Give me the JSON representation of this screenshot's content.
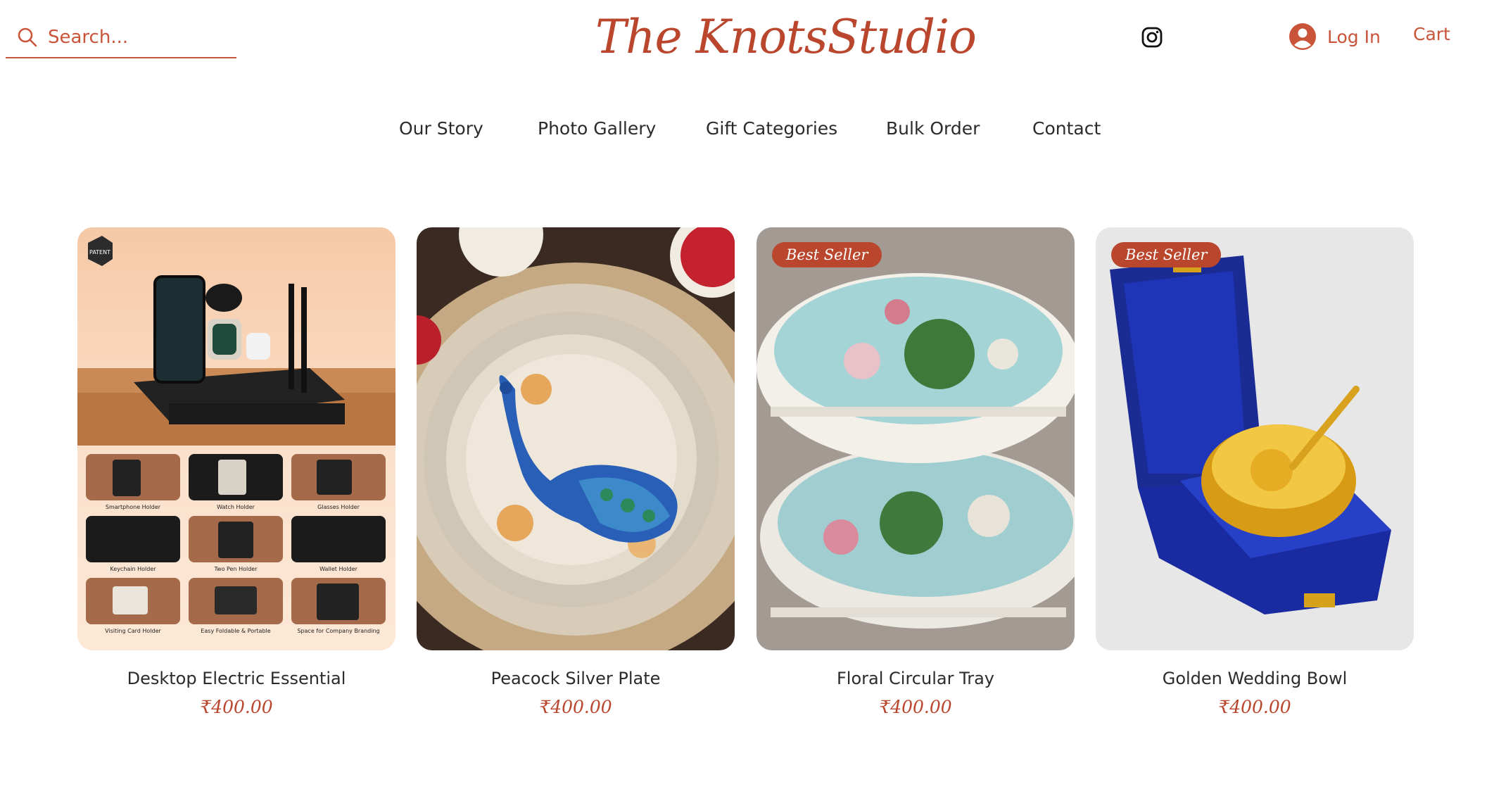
{
  "header": {
    "search_placeholder": "Search...",
    "logo": "The KnotsStudio",
    "login_label": "Log In",
    "cart_label": "Cart"
  },
  "nav": {
    "items": [
      "Our Story",
      "Photo Gallery",
      "Gift Categories",
      "Bulk Order",
      "Contact"
    ]
  },
  "products": [
    {
      "name": "Desktop Electric Essential",
      "price": "₹400.00",
      "badge": "",
      "image_labels": {
        "patent_badge": "PATENT",
        "cells": [
          "Smartphone Holder",
          "Watch Holder",
          "Glasses Holder",
          "Keychain Holder",
          "Two Pen Holder",
          "Wallet Holder",
          "Visiting Card Holder",
          "Easy Foldable & Portable",
          "Space for Company Branding"
        ]
      }
    },
    {
      "name": "Peacock Silver Plate",
      "price": "₹400.00",
      "badge": ""
    },
    {
      "name": "Floral Circular Tray",
      "price": "₹400.00",
      "badge": "Best Seller"
    },
    {
      "name": "Golden Wedding Bowl",
      "price": "₹400.00",
      "badge": "Best Seller"
    }
  ],
  "colors": {
    "accent": "#c9543a",
    "brand": "#b9462d",
    "text": "#2b2b2b"
  },
  "icons": [
    "search-icon",
    "instagram-icon",
    "user-avatar-icon"
  ]
}
